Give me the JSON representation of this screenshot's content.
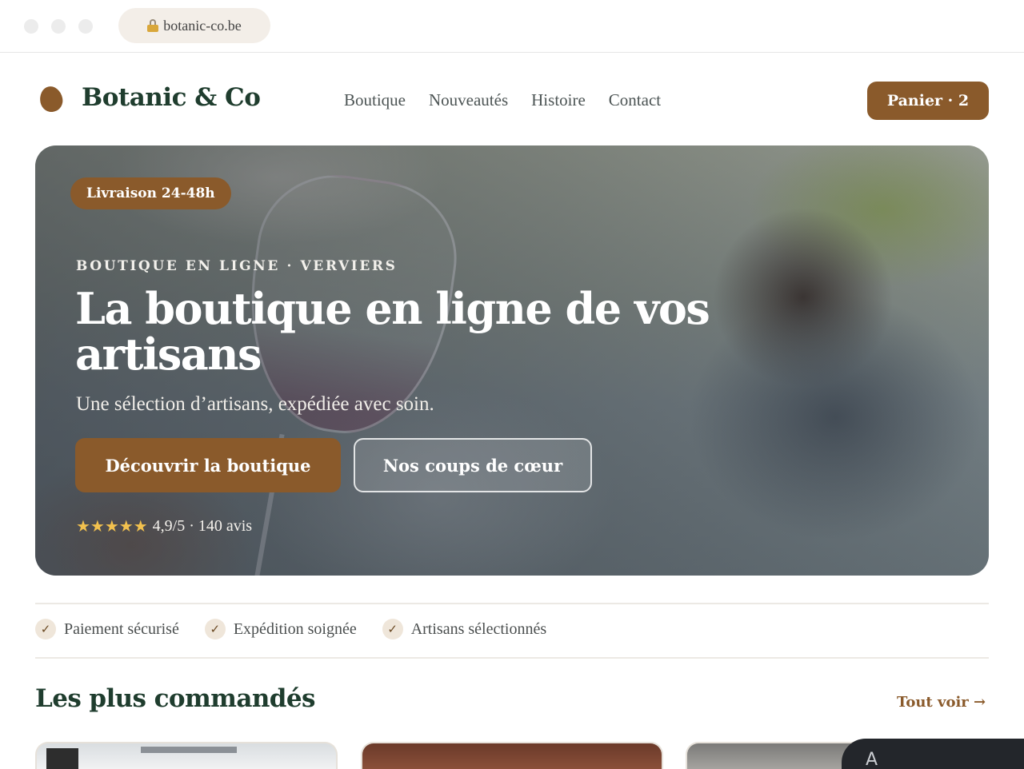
{
  "browser": {
    "url": "botanic-co.be"
  },
  "header": {
    "brand": "Botanic & Co",
    "nav": [
      "Boutique",
      "Nouveautés",
      "Histoire",
      "Contact"
    ],
    "cart_label": "Panier · 2"
  },
  "hero": {
    "badge": "Livraison 24-48h",
    "eyebrow": "BOUTIQUE EN LIGNE · VERVIERS",
    "title": "La boutique en ligne de vos artisans",
    "subtitle": "Une sélection d’artisans, expédiée avec soin.",
    "primary_cta": "Découvrir la boutique",
    "secondary_cta": "Nos coups de cœur",
    "stars": "★★★★★",
    "rating_text": "4,9/5 · 140 avis"
  },
  "trust": {
    "check_glyph": "✓",
    "items": [
      "Paiement sécurisé",
      "Expédition soignée",
      "Artisans sélectionnés"
    ]
  },
  "section": {
    "title": "Les plus commandés",
    "see_all": "Tout voir →"
  },
  "colors": {
    "brand_brown": "#8a5a2b",
    "brand_green": "#1f3d2e"
  }
}
